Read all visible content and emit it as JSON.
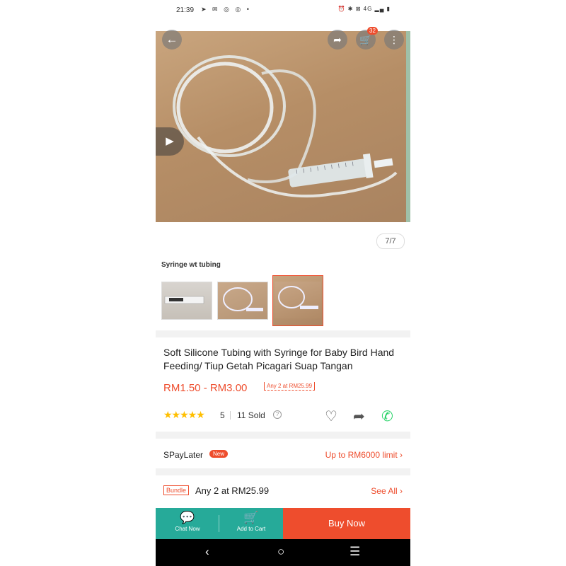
{
  "status_bar": {
    "time": "21:39",
    "left_icons": "➤ ✉ ◎ ◎ •",
    "right_icons": "⏰ ✱ ⊠ 4G ▂▄ ▮"
  },
  "header": {
    "back_icon": "arrow-left",
    "share_icon": "share",
    "cart_icon": "cart",
    "cart_count": "32",
    "more_icon": "more"
  },
  "gallery": {
    "counter": "7/7",
    "play_icon": "play"
  },
  "variation": {
    "title": "Syringe wt tubing",
    "thumbnails": [
      "thumb-1",
      "thumb-2",
      "thumb-3"
    ],
    "selected_index": 2
  },
  "product": {
    "title": "Soft Silicone Tubing with Syringe for Baby Bird Hand Feeding/ Tiup Getah Picagari Suap Tangan",
    "price": "RM1.50 - RM3.00",
    "deal_tag": "Any 2 at RM25.99",
    "stars": "★★★★★",
    "rating": "5",
    "sold": "11 Sold",
    "help": "?"
  },
  "spaylater": {
    "label": "SPayLater",
    "badge": "New",
    "right_text": "Up to RM6000 limit ›"
  },
  "bundle": {
    "tag": "Bundle",
    "text": "Any 2 at RM25.99",
    "see_all": "See All ›"
  },
  "bottom_bar": {
    "chat_label": "Chat Now",
    "cart_label": "Add to Cart",
    "buy_label": "Buy Now"
  },
  "colors": {
    "accent": "#ee4d2d",
    "teal": "#26aa99"
  }
}
